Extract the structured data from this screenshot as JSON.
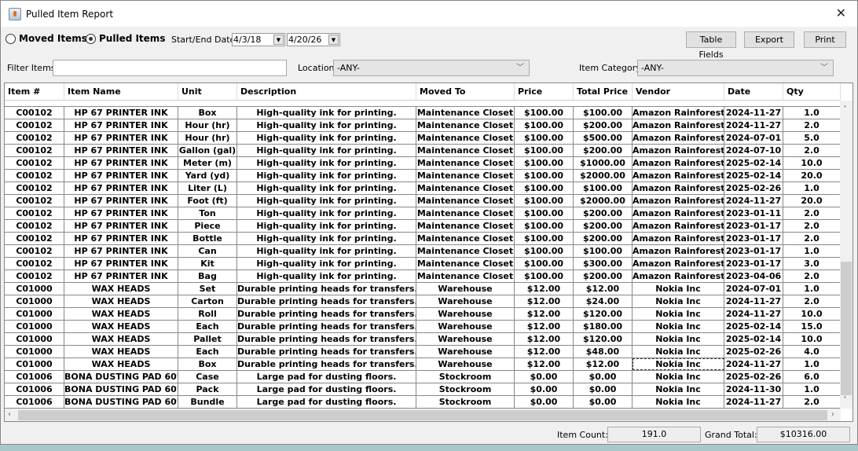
{
  "window": {
    "title": "Pulled Item Report",
    "close": "✕"
  },
  "toolbar": {
    "moved_items": "Moved Items",
    "pulled_items": "Pulled Items",
    "selected_mode": "pulled",
    "date_label": "Start/End Date:",
    "start_date": "4/3/18",
    "end_date": "4/20/26",
    "table_fields": "Table Fields",
    "export": "Export",
    "print": "Print"
  },
  "filters": {
    "filter_label": "Filter Items:",
    "filter_value": "",
    "location_label": "Location:",
    "location_value": "-ANY-",
    "category_label": "Item Category:",
    "category_value": "-ANY-"
  },
  "table": {
    "columns": [
      "Item #",
      "Item Name",
      "Unit",
      "Description",
      "Moved To",
      "Price",
      "Total Price",
      "Vendor",
      "Date",
      "Qty"
    ],
    "rows": [
      [
        "C00102",
        "HP 67 PRINTER INK",
        "Box",
        "High-quality ink for printing.",
        "Maintenance Closet",
        "$100.00",
        "$100.00",
        "Amazon Rainforest",
        "2024-11-27",
        "1.0"
      ],
      [
        "C00102",
        "HP 67 PRINTER INK",
        "Hour (hr)",
        "High-quality ink for printing.",
        "Maintenance Closet",
        "$100.00",
        "$200.00",
        "Amazon Rainforest",
        "2024-11-27",
        "2.0"
      ],
      [
        "C00102",
        "HP 67 PRINTER INK",
        "Hour (hr)",
        "High-quality ink for printing.",
        "Maintenance Closet",
        "$100.00",
        "$500.00",
        "Amazon Rainforest",
        "2024-07-01",
        "5.0"
      ],
      [
        "C00102",
        "HP 67 PRINTER INK",
        "Gallon (gal)",
        "High-quality ink for printing.",
        "Maintenance Closet",
        "$100.00",
        "$200.00",
        "Amazon Rainforest",
        "2024-07-10",
        "2.0"
      ],
      [
        "C00102",
        "HP 67 PRINTER INK",
        "Meter (m)",
        "High-quality ink for printing.",
        "Maintenance Closet",
        "$100.00",
        "$1000.00",
        "Amazon Rainforest",
        "2025-02-14",
        "10.0"
      ],
      [
        "C00102",
        "HP 67 PRINTER INK",
        "Yard (yd)",
        "High-quality ink for printing.",
        "Maintenance Closet",
        "$100.00",
        "$2000.00",
        "Amazon Rainforest",
        "2025-02-14",
        "20.0"
      ],
      [
        "C00102",
        "HP 67 PRINTER INK",
        "Liter (L)",
        "High-quality ink for printing.",
        "Maintenance Closet",
        "$100.00",
        "$100.00",
        "Amazon Rainforest",
        "2025-02-26",
        "1.0"
      ],
      [
        "C00102",
        "HP 67 PRINTER INK",
        "Foot (ft)",
        "High-quality ink for printing.",
        "Maintenance Closet",
        "$100.00",
        "$2000.00",
        "Amazon Rainforest",
        "2024-11-27",
        "20.0"
      ],
      [
        "C00102",
        "HP 67 PRINTER INK",
        "Ton",
        "High-quality ink for printing.",
        "Maintenance Closet",
        "$100.00",
        "$200.00",
        "Amazon Rainforest",
        "2023-01-11",
        "2.0"
      ],
      [
        "C00102",
        "HP 67 PRINTER INK",
        "Piece",
        "High-quality ink for printing.",
        "Maintenance Closet",
        "$100.00",
        "$200.00",
        "Amazon Rainforest",
        "2023-01-17",
        "2.0"
      ],
      [
        "C00102",
        "HP 67 PRINTER INK",
        "Bottle",
        "High-quality ink for printing.",
        "Maintenance Closet",
        "$100.00",
        "$200.00",
        "Amazon Rainforest",
        "2023-01-17",
        "2.0"
      ],
      [
        "C00102",
        "HP 67 PRINTER INK",
        "Can",
        "High-quality ink for printing.",
        "Maintenance Closet",
        "$100.00",
        "$100.00",
        "Amazon Rainforest",
        "2023-01-17",
        "1.0"
      ],
      [
        "C00102",
        "HP 67 PRINTER INK",
        "Kit",
        "High-quality ink for printing.",
        "Maintenance Closet",
        "$100.00",
        "$300.00",
        "Amazon Rainforest",
        "2023-01-17",
        "3.0"
      ],
      [
        "C00102",
        "HP 67 PRINTER INK",
        "Bag",
        "High-quality ink for printing.",
        "Maintenance Closet",
        "$100.00",
        "$200.00",
        "Amazon Rainforest",
        "2023-04-06",
        "2.0"
      ],
      [
        "C01000",
        "WAX HEADS",
        "Set",
        "Durable printing heads for transfers.",
        "Warehouse",
        "$12.00",
        "$12.00",
        "Nokia Inc",
        "2024-07-01",
        "1.0"
      ],
      [
        "C01000",
        "WAX HEADS",
        "Carton",
        "Durable printing heads for transfers.",
        "Warehouse",
        "$12.00",
        "$24.00",
        "Nokia Inc",
        "2024-11-27",
        "2.0"
      ],
      [
        "C01000",
        "WAX HEADS",
        "Roll",
        "Durable printing heads for transfers.",
        "Warehouse",
        "$12.00",
        "$120.00",
        "Nokia Inc",
        "2024-11-27",
        "10.0"
      ],
      [
        "C01000",
        "WAX HEADS",
        "Each",
        "Durable printing heads for transfers.",
        "Warehouse",
        "$12.00",
        "$180.00",
        "Nokia Inc",
        "2025-02-14",
        "15.0"
      ],
      [
        "C01000",
        "WAX HEADS",
        "Pallet",
        "Durable printing heads for transfers.",
        "Warehouse",
        "$12.00",
        "$120.00",
        "Nokia Inc",
        "2025-02-14",
        "10.0"
      ],
      [
        "C01000",
        "WAX HEADS",
        "Each",
        "Durable printing heads for transfers.",
        "Warehouse",
        "$12.00",
        "$48.00",
        "Nokia Inc",
        "2025-02-26",
        "4.0"
      ],
      [
        "C01000",
        "WAX HEADS",
        "Box",
        "Durable printing heads for transfers.",
        "Warehouse",
        "$12.00",
        "$12.00",
        "Nokia Inc",
        "2024-11-27",
        "1.0"
      ],
      [
        "C01006",
        "BONA DUSTING PAD 60\"",
        "Case",
        "Large pad for dusting floors.",
        "Stockroom",
        "$0.00",
        "$0.00",
        "Nokia Inc",
        "2025-02-26",
        "6.0"
      ],
      [
        "C01006",
        "BONA DUSTING PAD 60\"",
        "Pack",
        "Large pad for dusting floors.",
        "Stockroom",
        "$0.00",
        "$0.00",
        "Nokia Inc",
        "2024-11-30",
        "1.0"
      ],
      [
        "C01006",
        "BONA DUSTING PAD 60\"",
        "Bundle",
        "Large pad for dusting floors.",
        "Stockroom",
        "$0.00",
        "$0.00",
        "Nokia Inc",
        "2024-11-27",
        "2.0"
      ]
    ]
  },
  "footer": {
    "item_count_label": "Item Count:",
    "item_count": "191.0",
    "grand_total_label": "Grand Total:",
    "grand_total": "$10316.00"
  }
}
